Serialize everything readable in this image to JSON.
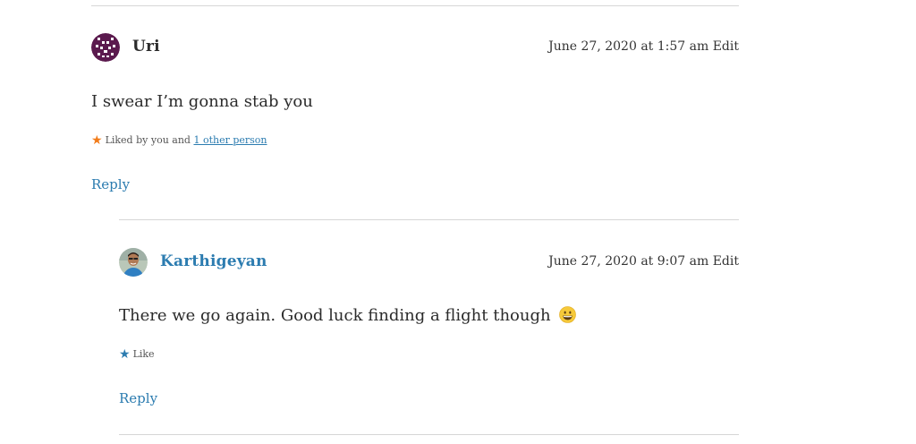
{
  "comments": [
    {
      "author": "Uri",
      "date": "June 27, 2020 at 1:57 am",
      "edit_label": "Edit",
      "text": "I swear I’m gonna stab you",
      "likes": {
        "prefix": "Liked by you and",
        "link": "1 other person"
      },
      "reply_label": "Reply",
      "avatar_icon": "identicon-avatar"
    },
    {
      "author": "Karthigeyan",
      "date": "June 27, 2020 at 9:07 am",
      "edit_label": "Edit",
      "text": "There we go again. Good luck finding a flight though",
      "emoji_icon": "grinning-face-emoji",
      "likes": {
        "label": "Like"
      },
      "reply_label": "Reply",
      "avatar_icon": "user-photo-avatar"
    }
  ],
  "colors": {
    "link": "#2c7cb0",
    "liked_star": "#f27c1a",
    "like_star": "#2c7cb0",
    "divider": "#d6d6d6",
    "identicon": "#5b1a4e"
  }
}
